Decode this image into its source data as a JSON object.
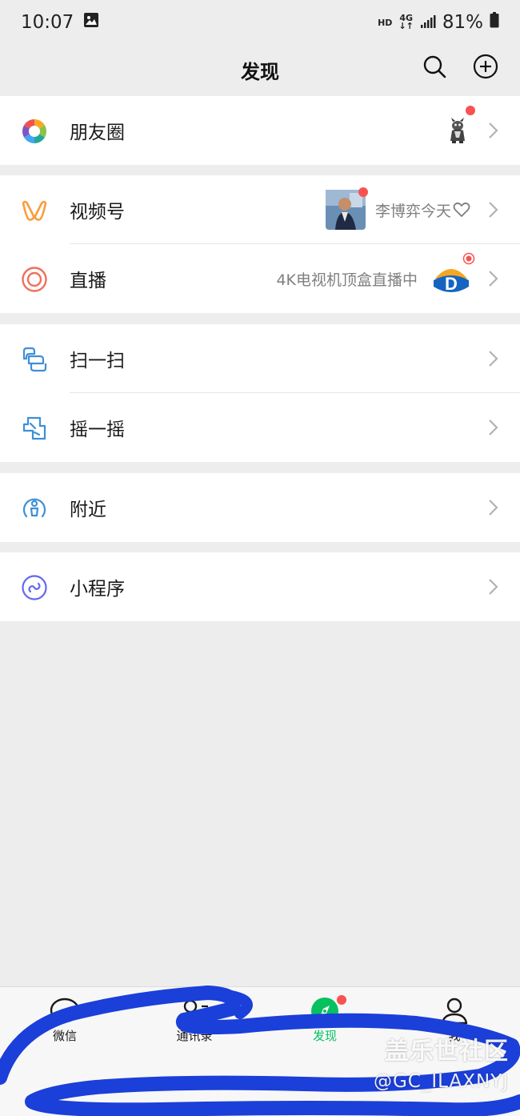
{
  "status_bar": {
    "time": "10:07",
    "hd": "HD",
    "network": "4G",
    "battery": "81%"
  },
  "header": {
    "title": "发现"
  },
  "items": {
    "moments": {
      "label": "朋友圈"
    },
    "channels": {
      "label": "视频号",
      "subtitle": "李博弈今天"
    },
    "live": {
      "label": "直播",
      "subtitle": "4K电视机顶盒直播中"
    },
    "scan": {
      "label": "扫一扫"
    },
    "shake": {
      "label": "摇一摇"
    },
    "nearby": {
      "label": "附近"
    },
    "mini_programs": {
      "label": "小程序"
    }
  },
  "tabs": [
    {
      "label": "微信",
      "active": false
    },
    {
      "label": "通讯录",
      "active": false
    },
    {
      "label": "发现",
      "active": true
    },
    {
      "label": "我",
      "active": false
    }
  ],
  "watermark": {
    "line1": "盖乐世社区",
    "line2": "@GC_ILAXNYJ"
  },
  "colors": {
    "accent_green": "#07c160",
    "badge_red": "#fa5151",
    "background": "#ededed",
    "scribble_blue": "#1b3fd9"
  }
}
